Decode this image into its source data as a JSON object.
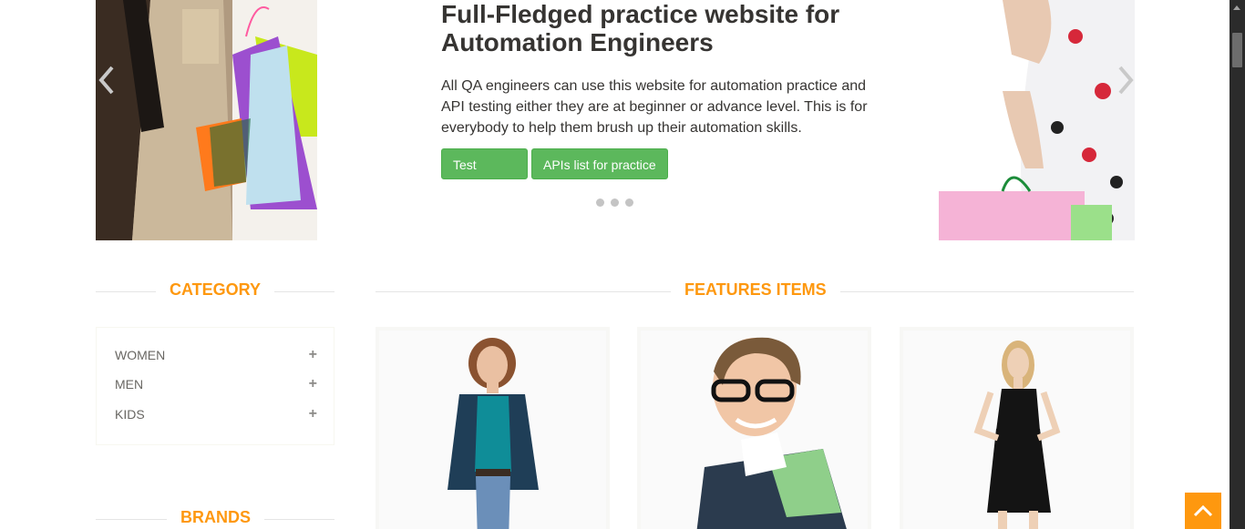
{
  "slider": {
    "heading": "Full-Fledged practice website for Automation Engineers",
    "description": "All QA engineers can use this website for automation practice and API testing either they are at beginner or advance level. This is for everybody to help them brush up their automation skills.",
    "buttons": {
      "test_cases": "Test Cases",
      "apis_list": "APIs list for practice"
    },
    "active_slide": 1,
    "slide_count": 3
  },
  "sections": {
    "category": "CATEGORY",
    "features": "FEATURES ITEMS",
    "brands": "BRANDS"
  },
  "categories": [
    {
      "label": "WOMEN",
      "expand_icon": "plus-icon"
    },
    {
      "label": "MEN",
      "expand_icon": "plus-icon"
    },
    {
      "label": "KIDS",
      "expand_icon": "plus-icon"
    }
  ],
  "colors": {
    "accent": "#fe980f",
    "button": "#5cb85c",
    "text": "#363432"
  },
  "icons": {
    "prev": "chevron-left-icon",
    "next": "chevron-right-icon",
    "scroll_top": "chevron-up-icon"
  }
}
